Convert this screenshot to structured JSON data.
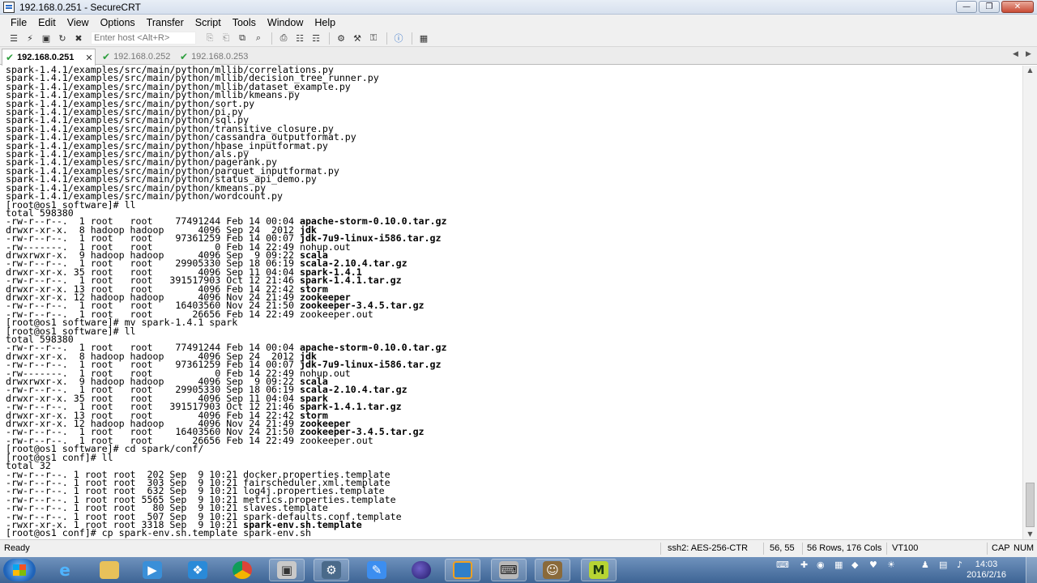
{
  "window": {
    "title": "192.168.0.251 - SecureCRT"
  },
  "menu": [
    "File",
    "Edit",
    "View",
    "Options",
    "Transfer",
    "Script",
    "Tools",
    "Window",
    "Help"
  ],
  "toolbar": {
    "host_placeholder": "Enter host <Alt+R>"
  },
  "tabs": [
    {
      "label": "192.168.0.251",
      "active": true
    },
    {
      "label": "192.168.0.252",
      "active": false
    },
    {
      "label": "192.168.0.253",
      "active": false
    }
  ],
  "terminal": {
    "lines": [
      [
        {
          "t": "spark-1.4.1/examples/src/main/python/mllib/correlations.py"
        }
      ],
      [
        {
          "t": "spark-1.4.1/examples/src/main/python/mllib/decision_tree_runner.py"
        }
      ],
      [
        {
          "t": "spark-1.4.1/examples/src/main/python/mllib/dataset_example.py"
        }
      ],
      [
        {
          "t": "spark-1.4.1/examples/src/main/python/mllib/kmeans.py"
        }
      ],
      [
        {
          "t": "spark-1.4.1/examples/src/main/python/sort.py"
        }
      ],
      [
        {
          "t": "spark-1.4.1/examples/src/main/python/pi.py"
        }
      ],
      [
        {
          "t": "spark-1.4.1/examples/src/main/python/sql.py"
        }
      ],
      [
        {
          "t": "spark-1.4.1/examples/src/main/python/transitive_closure.py"
        }
      ],
      [
        {
          "t": "spark-1.4.1/examples/src/main/python/cassandra_outputformat.py"
        }
      ],
      [
        {
          "t": "spark-1.4.1/examples/src/main/python/hbase_inputformat.py"
        }
      ],
      [
        {
          "t": "spark-1.4.1/examples/src/main/python/als.py"
        }
      ],
      [
        {
          "t": "spark-1.4.1/examples/src/main/python/pagerank.py"
        }
      ],
      [
        {
          "t": "spark-1.4.1/examples/src/main/python/parquet_inputformat.py"
        }
      ],
      [
        {
          "t": "spark-1.4.1/examples/src/main/python/status_api_demo.py"
        }
      ],
      [
        {
          "t": "spark-1.4.1/examples/src/main/python/kmeans.py"
        }
      ],
      [
        {
          "t": "spark-1.4.1/examples/src/main/python/wordcount.py"
        }
      ],
      [
        {
          "t": "[root@os1 software]# ll"
        }
      ],
      [
        {
          "t": "total 598380"
        }
      ],
      [
        {
          "t": "-rw-r--r--.  1 root   root    77491244 Feb 14 00:04 "
        },
        {
          "t": "apache-storm-0.10.0.tar.gz",
          "b": true
        }
      ],
      [
        {
          "t": "drwxr-xr-x.  8 hadoop hadoop      4096 Sep 24  2012 "
        },
        {
          "t": "jdk",
          "b": true
        }
      ],
      [
        {
          "t": "-rw-r--r--.  1 root   root    97361259 Feb 14 00:07 "
        },
        {
          "t": "jdk-7u9-linux-i586.tar.gz",
          "b": true
        }
      ],
      [
        {
          "t": "-rw-------.  1 root   root           0 Feb 14 22:49 nohup.out"
        }
      ],
      [
        {
          "t": "drwxrwxr-x.  9 hadoop hadoop      4096 Sep  9 09:22 "
        },
        {
          "t": "scala",
          "b": true
        }
      ],
      [
        {
          "t": "-rw-r--r--.  1 root   root    29905330 Sep 18 06:19 "
        },
        {
          "t": "scala-2.10.4.tar.gz",
          "b": true
        }
      ],
      [
        {
          "t": "drwxr-xr-x. 35 root   root        4096 Sep 11 04:04 "
        },
        {
          "t": "spark-1.4.1",
          "b": true
        }
      ],
      [
        {
          "t": "-rw-r--r--.  1 root   root   391517903 Oct 12 21:46 "
        },
        {
          "t": "spark-1.4.1.tar.gz",
          "b": true
        }
      ],
      [
        {
          "t": "drwxr-xr-x. 13 root   root        4096 Feb 14 22:42 "
        },
        {
          "t": "storm",
          "b": true
        }
      ],
      [
        {
          "t": "drwxr-xr-x. 12 hadoop hadoop      4096 Nov 24 21:49 "
        },
        {
          "t": "zookeeper",
          "b": true
        }
      ],
      [
        {
          "t": "-rw-r--r--.  1 root   root    16403560 Nov 24 21:50 "
        },
        {
          "t": "zookeeper-3.4.5.tar.gz",
          "b": true
        }
      ],
      [
        {
          "t": "-rw-r--r--.  1 root   root       26656 Feb 14 22:49 zookeeper.out"
        }
      ],
      [
        {
          "t": "[root@os1 software]# mv spark-1.4.1 spark"
        }
      ],
      [
        {
          "t": "[root@os1 software]# ll"
        }
      ],
      [
        {
          "t": "total 598380"
        }
      ],
      [
        {
          "t": "-rw-r--r--.  1 root   root    77491244 Feb 14 00:04 "
        },
        {
          "t": "apache-storm-0.10.0.tar.gz",
          "b": true
        }
      ],
      [
        {
          "t": "drwxr-xr-x.  8 hadoop hadoop      4096 Sep 24  2012 "
        },
        {
          "t": "jdk",
          "b": true
        }
      ],
      [
        {
          "t": "-rw-r--r--.  1 root   root    97361259 Feb 14 00:07 "
        },
        {
          "t": "jdk-7u9-linux-i586.tar.gz",
          "b": true
        }
      ],
      [
        {
          "t": "-rw-------.  1 root   root           0 Feb 14 22:49 nohup.out"
        }
      ],
      [
        {
          "t": "drwxrwxr-x.  9 hadoop hadoop      4096 Sep  9 09:22 "
        },
        {
          "t": "scala",
          "b": true
        }
      ],
      [
        {
          "t": "-rw-r--r--.  1 root   root    29905330 Sep 18 06:19 "
        },
        {
          "t": "scala-2.10.4.tar.gz",
          "b": true
        }
      ],
      [
        {
          "t": "drwxr-xr-x. 35 root   root        4096 Sep 11 04:04 "
        },
        {
          "t": "spark",
          "b": true
        }
      ],
      [
        {
          "t": "-rw-r--r--.  1 root   root   391517903 Oct 12 21:46 "
        },
        {
          "t": "spark-1.4.1.tar.gz",
          "b": true
        }
      ],
      [
        {
          "t": "drwxr-xr-x. 13 root   root        4096 Feb 14 22:42 "
        },
        {
          "t": "storm",
          "b": true
        }
      ],
      [
        {
          "t": "drwxr-xr-x. 12 hadoop hadoop      4096 Nov 24 21:49 "
        },
        {
          "t": "zookeeper",
          "b": true
        }
      ],
      [
        {
          "t": "-rw-r--r--.  1 root   root    16403560 Nov 24 21:50 "
        },
        {
          "t": "zookeeper-3.4.5.tar.gz",
          "b": true
        }
      ],
      [
        {
          "t": "-rw-r--r--.  1 root   root       26656 Feb 14 22:49 zookeeper.out"
        }
      ],
      [
        {
          "t": "[root@os1 software]# cd spark/conf/"
        }
      ],
      [
        {
          "t": "[root@os1 conf]# ll"
        }
      ],
      [
        {
          "t": "total 32"
        }
      ],
      [
        {
          "t": "-rw-r--r--. 1 root root  202 Sep  9 10:21 docker.properties.template"
        }
      ],
      [
        {
          "t": "-rw-r--r--. 1 root root  303 Sep  9 10:21 fairscheduler.xml.template"
        }
      ],
      [
        {
          "t": "-rw-r--r--. 1 root root  632 Sep  9 10:21 log4j.properties.template"
        }
      ],
      [
        {
          "t": "-rw-r--r--. 1 root root 5565 Sep  9 10:21 metrics.properties.template"
        }
      ],
      [
        {
          "t": "-rw-r--r--. 1 root root   80 Sep  9 10:21 slaves.template"
        }
      ],
      [
        {
          "t": "-rw-r--r--. 1 root root  507 Sep  9 10:21 spark-defaults.conf.template"
        }
      ],
      [
        {
          "t": "-rwxr-xr-x. 1 root root 3318 Sep  9 10:21 "
        },
        {
          "t": "spark-env.sh.template",
          "b": true
        }
      ],
      [
        {
          "t": "[root@os1 conf]# cp spark-env.sh.template spark-env.sh"
        }
      ]
    ]
  },
  "statusbar": {
    "ready": "Ready",
    "cipher": "ssh2: AES-256-CTR",
    "cursor": "56,  55",
    "size": "56 Rows, 176 Cols",
    "emulation": "VT100",
    "caps": "CAP",
    "num": "NUM"
  },
  "taskbar": {
    "apps": [
      "ie-icon",
      "explorer-icon",
      "media-player-icon",
      "network-tool-icon",
      "chrome-icon",
      "securecrt-session-icon",
      "remote-desktop-icon",
      "paint-tool-icon",
      "eclipse-icon",
      "vbox-icon",
      "securecrt-icon",
      "game-icon",
      "m-app-icon"
    ],
    "time": "14:03",
    "date": "2016/2/16"
  },
  "colors": {
    "active_tab_check": "#2e9e3e",
    "taskbar": "#4a72a4"
  }
}
